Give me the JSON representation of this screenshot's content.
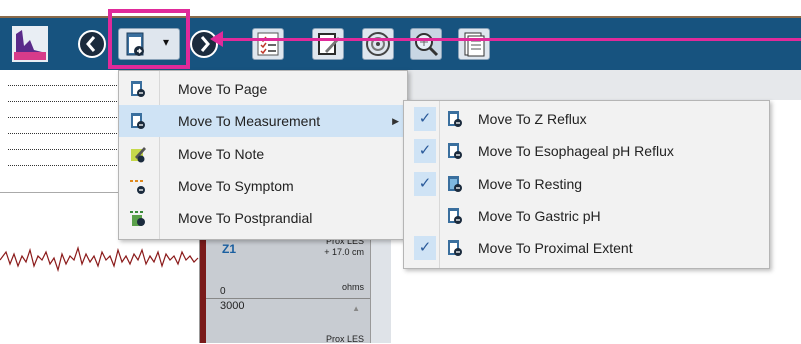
{
  "toolbar": {
    "dropdown_arrow": "▾",
    "buttons": [
      {
        "name": "app-logo-icon"
      },
      {
        "name": "back-icon"
      },
      {
        "name": "move-to-dropdown-icon"
      },
      {
        "name": "forward-icon"
      },
      {
        "name": "checklist-icon"
      },
      {
        "name": "edit-report-icon"
      },
      {
        "name": "analysis-icon"
      },
      {
        "name": "zoom-icon"
      },
      {
        "name": "document-icon"
      }
    ]
  },
  "colors": {
    "toolbar": "#17537f",
    "highlight": "#e02a9a",
    "menu_hover": "#cfe3f5",
    "check": "#2a5a9a"
  },
  "main_menu": {
    "items": [
      {
        "label": "Move To Page",
        "icon": "page-icon"
      },
      {
        "label": "Move To Measurement",
        "icon": "measurement-icon",
        "submenu_arrow": "▶"
      },
      {
        "label": "Move To Note",
        "icon": "note-icon"
      },
      {
        "label": "Move To Symptom",
        "icon": "symptom-icon"
      },
      {
        "label": "Move To Postprandial",
        "icon": "postprandial-icon"
      }
    ]
  },
  "sub_menu": {
    "items": [
      {
        "label": "Move To Z Reflux",
        "check": "✓"
      },
      {
        "label": "Move To Esophageal pH Reflux",
        "check": "✓"
      },
      {
        "label": "Move To Resting",
        "check": "✓"
      },
      {
        "label": "Move To Gastric pH",
        "check": ""
      },
      {
        "label": "Move To Proximal Extent",
        "check": "✓"
      }
    ]
  },
  "channel": {
    "name": "Z1",
    "location_line1": "Prox LES",
    "location_line2": "+ 17.0 cm",
    "unit": "ohms",
    "axis_min": "0",
    "next_value": "3000",
    "next_arrow": "▲",
    "next_location": "Prox LES"
  }
}
